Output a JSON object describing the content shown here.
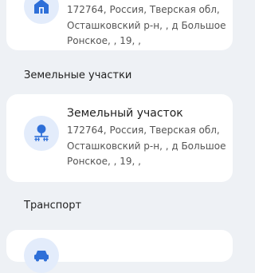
{
  "top_card": {
    "icon": "house-icon",
    "address_lines": [
      "172764, Россия, Тверская обл,",
      "Осташковский р-н, , д Большое",
      "Ронское, , 19, ,"
    ]
  },
  "land_section": {
    "title": "Земельные участки",
    "card": {
      "icon": "land-plot-icon",
      "title": "Земельный участок",
      "address_lines": [
        "172764, Россия, Тверская обл,",
        "Осташковский р-н, , д Большое",
        "Ронское, , 19, ,"
      ]
    }
  },
  "transport_section": {
    "title": "Транспорт",
    "card": {
      "icon": "car-icon"
    }
  },
  "colors": {
    "accent": "#2e6fd8",
    "icon_bg": "#e3ecfb",
    "page_bg": "#eef1f5"
  }
}
